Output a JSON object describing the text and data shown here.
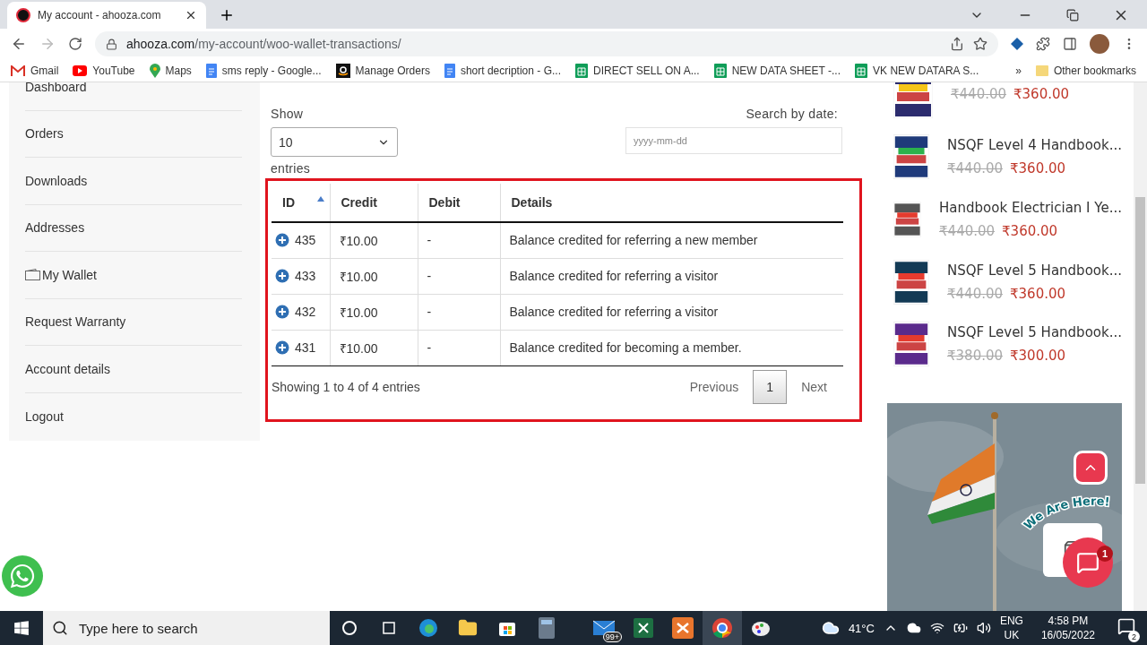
{
  "browser": {
    "tab": {
      "title": "My account - ahooza.com"
    },
    "url": {
      "domain": "ahooza.com",
      "path": "/my-account/woo-wallet-transactions/"
    },
    "bookmarks": [
      {
        "label": "Gmail",
        "kind": "gmail"
      },
      {
        "label": "YouTube",
        "kind": "youtube"
      },
      {
        "label": "Maps",
        "kind": "maps"
      },
      {
        "label": "sms reply - Google...",
        "kind": "docs"
      },
      {
        "label": "Manage Orders",
        "kind": "amazon"
      },
      {
        "label": "short decription - G...",
        "kind": "docs"
      },
      {
        "label": "DIRECT SELL ON A...",
        "kind": "sheets"
      },
      {
        "label": "NEW DATA SHEET -...",
        "kind": "sheets"
      },
      {
        "label": "VK NEW DATARA S...",
        "kind": "sheets"
      }
    ],
    "more_bookmarks": "»",
    "other_bookmarks": "Other bookmarks"
  },
  "account_nav": [
    {
      "label": "Dashboard",
      "kind": "plain"
    },
    {
      "label": "Orders",
      "kind": "plain"
    },
    {
      "label": "Downloads",
      "kind": "plain"
    },
    {
      "label": "Addresses",
      "kind": "plain"
    },
    {
      "label": "My Wallet",
      "kind": "wallet"
    },
    {
      "label": "Request Warranty",
      "kind": "plain"
    },
    {
      "label": "Account details",
      "kind": "plain"
    },
    {
      "label": "Logout",
      "kind": "plain"
    }
  ],
  "transactions": {
    "show_label": "Show",
    "page_size": "10",
    "entries_label": "entries",
    "search_label": "Search by date:",
    "search_placeholder": "yyyy-mm-dd",
    "columns": [
      {
        "label": "ID",
        "sorted": true
      },
      {
        "label": "Credit",
        "sorted": false
      },
      {
        "label": "Debit",
        "sorted": false
      },
      {
        "label": "Details",
        "sorted": false
      }
    ],
    "rows": [
      {
        "id": "435",
        "credit": "₹10.00",
        "debit": "-",
        "details": "Balance credited for referring a new member"
      },
      {
        "id": "433",
        "credit": "₹10.00",
        "debit": "-",
        "details": "Balance credited for referring a visitor"
      },
      {
        "id": "432",
        "credit": "₹10.00",
        "debit": "-",
        "details": "Balance credited for referring a visitor"
      },
      {
        "id": "431",
        "credit": "₹10.00",
        "debit": "-",
        "details": "Balance credited for becoming a member."
      }
    ],
    "summary": "Showing 1 to 4 of 4 entries",
    "pagination": {
      "previous": "Previous",
      "pages": [
        {
          "label": "1",
          "selected": true
        }
      ],
      "next": "Next"
    }
  },
  "products": [
    {
      "old_price": "₹440.00",
      "price": "₹360.00"
    },
    {
      "title": "NSQF Level 4 Handbook...",
      "old_price": "₹440.00",
      "price": "₹360.00"
    },
    {
      "title": "Handbook Electrician I Ye...",
      "old_price": "₹440.00",
      "price": "₹360.00"
    },
    {
      "title": "NSQF Level 5 Handbook...",
      "old_price": "₹440.00",
      "price": "₹360.00"
    },
    {
      "title": "NSQF Level 5 Handbook...",
      "old_price": "₹380.00",
      "price": "₹300.00"
    }
  ],
  "chat": {
    "caption": "We Are Here!",
    "badge": "1"
  },
  "taskbar": {
    "search_placeholder": "Type here to search",
    "mail_badge": "99+",
    "temperature": "41°C",
    "language": "ENG",
    "region": "UK",
    "time": "4:58 PM",
    "date": "16/05/2022",
    "notification_count": "2"
  }
}
